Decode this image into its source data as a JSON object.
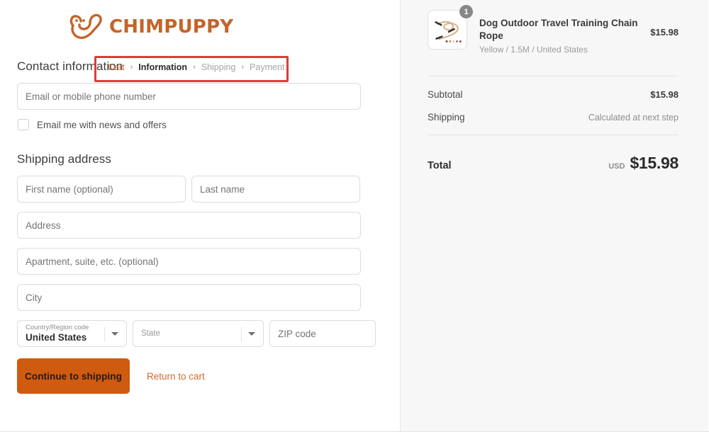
{
  "brand": {
    "name": "CHIMPUPPY",
    "logo_icon": "dog-heart-logo-icon",
    "color": "#c4642a"
  },
  "breadcrumb": {
    "annotation_color": "#e03b3b",
    "items": [
      {
        "label": "Cart",
        "state": "link"
      },
      {
        "label": "Information",
        "state": "current"
      },
      {
        "label": "Shipping",
        "state": "upcoming"
      },
      {
        "label": "Payment",
        "state": "upcoming"
      }
    ],
    "separator": "›"
  },
  "contact": {
    "heading": "Contact information",
    "email_placeholder": "Email or mobile phone number",
    "email_value": "",
    "newsletter_label": "Email me with news and offers",
    "newsletter_checked": false
  },
  "shipping": {
    "heading": "Shipping address",
    "first_name_placeholder": "First name (optional)",
    "first_name_value": "",
    "last_name_placeholder": "Last name",
    "last_name_value": "",
    "address_placeholder": "Address",
    "address_value": "",
    "apartment_placeholder": "Apartment, suite, etc. (optional)",
    "apartment_value": "",
    "city_placeholder": "City",
    "city_value": "",
    "country_label": "Country/Region code",
    "country_value": "United States",
    "state_placeholder": "State",
    "state_value": "",
    "zip_placeholder": "ZIP code",
    "zip_value": ""
  },
  "actions": {
    "continue_label": "Continue to shipping",
    "continue_color": "#cf5b10",
    "return_label": "Return to cart",
    "return_color": "#d2692e"
  },
  "summary": {
    "item": {
      "title": "Dog Outdoor Travel Training Chain Rope",
      "variant": "Yellow / 1.5M / United States",
      "price": "$15.98",
      "quantity": "1",
      "thumbnail_icon": "rope-leash-product-icon"
    },
    "rows": [
      {
        "label": "Subtotal",
        "value": "$15.98",
        "muted": false
      },
      {
        "label": "Shipping",
        "value": "Calculated at next step",
        "muted": true
      }
    ],
    "total": {
      "label": "Total",
      "currency": "USD",
      "amount": "$15.98"
    }
  }
}
